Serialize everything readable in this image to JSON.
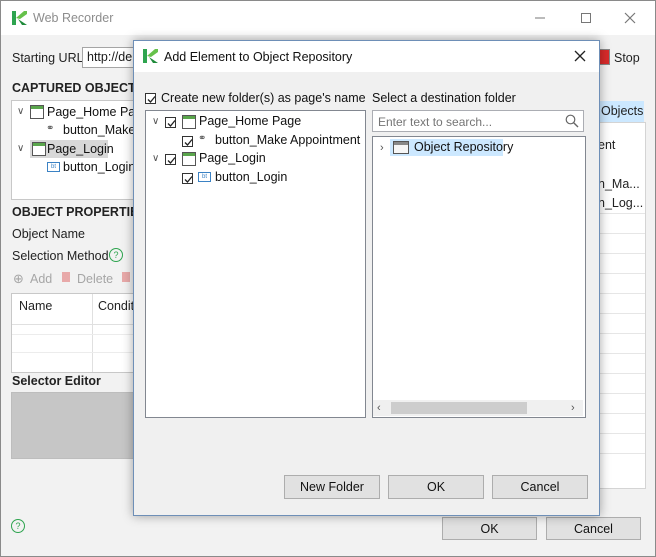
{
  "background_window": {
    "title": "Web Recorder",
    "starting_url_label": "Starting URL",
    "starting_url_value": "http://de",
    "stop_label": "Stop",
    "captured_objects_label": "CAPTURED OBJECTS",
    "captured_tree": [
      {
        "label": "Page_Home Page"
      },
      {
        "label": "button_Make"
      },
      {
        "label": "Page_Login"
      },
      {
        "label": "button_Login"
      }
    ],
    "object_properties_label": "OBJECT PROPERTIES",
    "object_name_label": "Object Name",
    "selection_method_label": "Selection Method",
    "add_label": "Add",
    "delete_label": "Delete",
    "table_columns": [
      "Name",
      "Conditi"
    ],
    "selector_editor_label": "Selector Editor",
    "right_tab_label": "Objects",
    "right_column_header": "ent",
    "right_rows": [
      "n_Ma...",
      "n_Log..."
    ],
    "ok_label": "OK",
    "cancel_label": "Cancel"
  },
  "dialog": {
    "title": "Add Element to Object Repository",
    "create_folder_label": "Create new folder(s) as page's name",
    "destination_label": "Select a destination folder",
    "search_placeholder": "Enter text to search...",
    "elements_tree": [
      {
        "label": "Page_Home Page",
        "checked": true
      },
      {
        "label": "button_Make Appointment",
        "checked": true
      },
      {
        "label": "Page_Login",
        "checked": true
      },
      {
        "label": "button_Login",
        "checked": true
      }
    ],
    "destination_root": "Object Repository",
    "new_folder_label": "New Folder",
    "ok_label": "OK",
    "cancel_label": "Cancel"
  },
  "colors": {
    "accent_blue": "#0078d7",
    "selection_blue": "#cce8ff",
    "katalon_green": "#2ea44f",
    "dialog_bg": "#f0f0f0"
  }
}
